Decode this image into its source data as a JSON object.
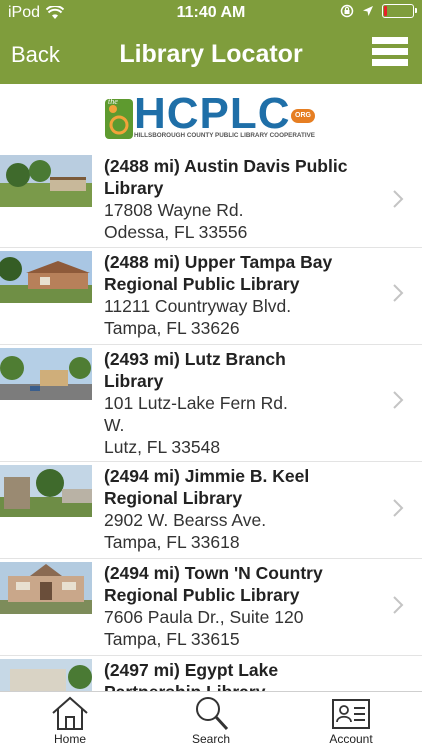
{
  "status_bar": {
    "carrier": "iPod",
    "time": "11:40 AM",
    "icons": [
      "wifi-icon",
      "orientation-lock-icon",
      "location-arrow-icon",
      "battery-icon"
    ],
    "battery_color": "#e8202a"
  },
  "nav": {
    "back_label": "Back",
    "title": "Library Locator",
    "menu_icon": "hamburger-menu-icon",
    "bar_color": "#7f9d3c"
  },
  "logo": {
    "text": "HCPLC",
    "org_badge": "ORG",
    "subtitle": "HILLSBOROUGH COUNTY PUBLIC LIBRARY COOPERATIVE",
    "brand_color": "#1f6fa8"
  },
  "libraries": [
    {
      "title_1": "(2488 mi) Austin Davis Public",
      "title_2": "Library",
      "addr_1": "17808 Wayne Rd.",
      "addr_2": "Odessa, FL 33556",
      "addr_3": ""
    },
    {
      "title_1": "(2488 mi) Upper Tampa Bay",
      "title_2": "Regional Public Library",
      "addr_1": "11211 Countryway Blvd.",
      "addr_2": "Tampa, FL 33626",
      "addr_3": ""
    },
    {
      "title_1": "(2493 mi) Lutz Branch",
      "title_2": "Library",
      "addr_1": "101 Lutz-Lake Fern Rd.",
      "addr_2": "W.",
      "addr_3": "Lutz, FL 33548"
    },
    {
      "title_1": "(2494 mi) Jimmie B. Keel",
      "title_2": "Regional Library",
      "addr_1": "2902 W. Bearss Ave.",
      "addr_2": "Tampa, FL 33618",
      "addr_3": ""
    },
    {
      "title_1": "(2494 mi) Town 'N Country",
      "title_2": "Regional Public Library",
      "addr_1": "7606 Paula Dr., Suite 120",
      "addr_2": "Tampa, FL 33615",
      "addr_3": ""
    },
    {
      "title_1": "(2497 mi) Egypt Lake",
      "title_2": "Partnership Library",
      "addr_1": "",
      "addr_2": "",
      "addr_3": ""
    }
  ],
  "tabs": [
    {
      "label": "Home",
      "icon": "home-icon"
    },
    {
      "label": "Search",
      "icon": "search-icon"
    },
    {
      "label": "Account",
      "icon": "account-card-icon"
    }
  ]
}
